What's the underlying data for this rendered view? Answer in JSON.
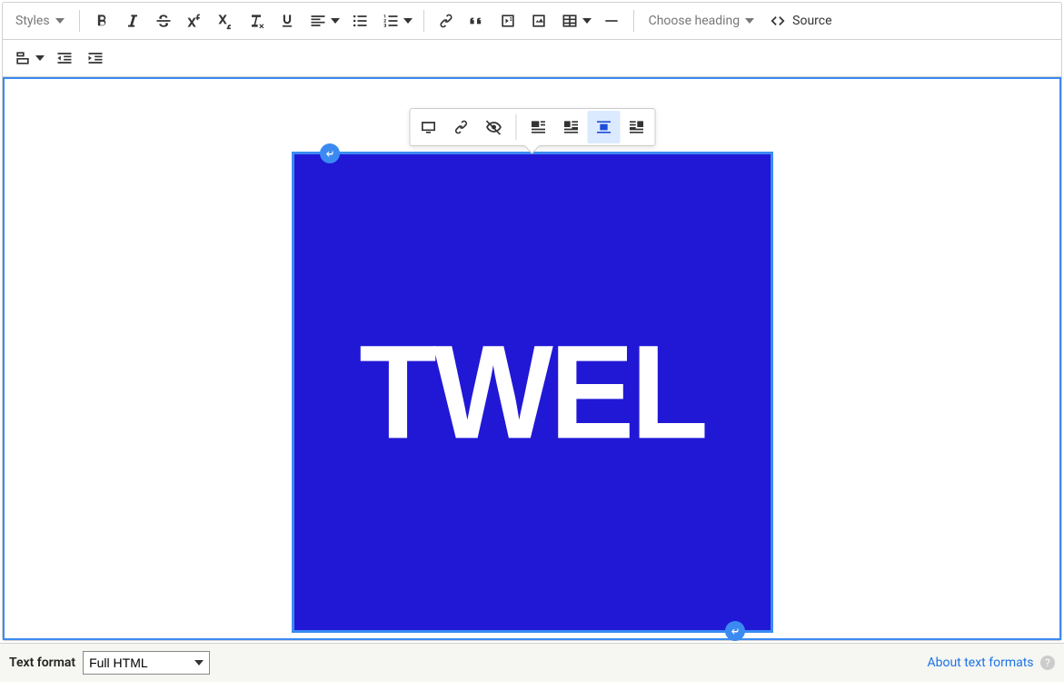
{
  "toolbar": {
    "styles_label": "Styles",
    "heading_label": "Choose heading",
    "source_label": "Source"
  },
  "image": {
    "logo_text": "TWEL"
  },
  "footer": {
    "text_format_label": "Text format",
    "text_format_value": "Full HTML",
    "about_link": "About text formats"
  }
}
